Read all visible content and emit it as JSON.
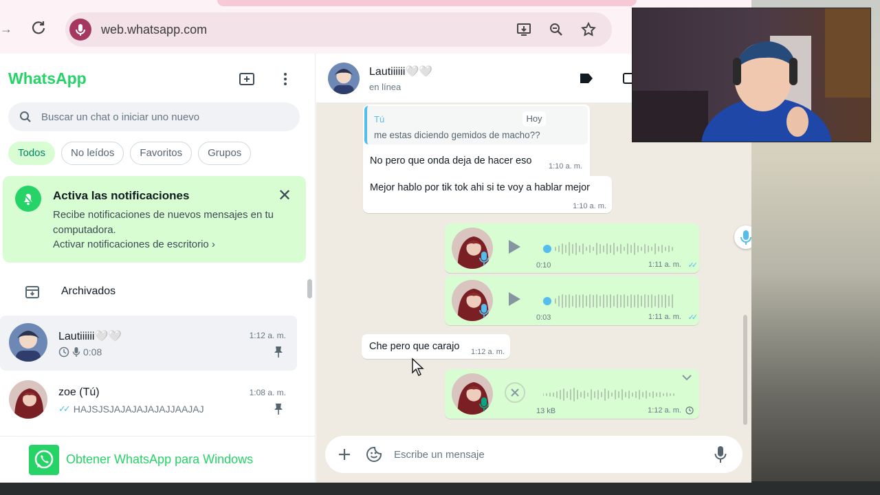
{
  "browser": {
    "url": "web.whatsapp.com"
  },
  "sidebar": {
    "brand": "WhatsApp",
    "search_placeholder": "Buscar un chat o iniciar uno nuevo",
    "filters": [
      "Todos",
      "No leídos",
      "Favoritos",
      "Grupos"
    ],
    "notification": {
      "title": "Activa las notificaciones",
      "body": "Recibe notificaciones de nuevos mensajes en tu computadora.",
      "link": "Activar notificaciones de escritorio ›"
    },
    "archived_label": "Archivados",
    "chats": [
      {
        "name": "Lautiiiiii🤍🤍",
        "time": "1:12 a. m.",
        "preview": "0:08"
      },
      {
        "name": "zoe (Tú)",
        "time": "1:08 a. m.",
        "preview": "HAJSJSJAJAJAJAJAJJAAJAJ"
      }
    ],
    "get_app_label": "Obtener WhatsApp para Windows"
  },
  "chat": {
    "contact_name": "Lautiiiiii🤍🤍",
    "contact_status": "en línea",
    "quote_author": "Tú",
    "quote_text": "me estas diciendo gemidos de macho??",
    "quote_day": "Hoy",
    "messages": [
      {
        "text": "No pero que onda deja de hacer eso",
        "time": "1:10 a. m."
      },
      {
        "text": "Mejor hablo por tik tok ahi si te voy a hablar mejor",
        "time": "1:10 a. m."
      },
      {
        "text": "Che pero que carajo",
        "time": "1:12 a. m."
      }
    ],
    "voice_notes": [
      {
        "duration": "0:10",
        "time": "1:11 a. m.",
        "progress": 0
      },
      {
        "duration": "0:03",
        "time": "1:11 a. m.",
        "progress": 0
      },
      {
        "duration": "13 kB",
        "time": "1:12 a. m.",
        "progress": 0
      }
    ],
    "compose_placeholder": "Escribe un mensaje"
  },
  "colors": {
    "brand_green": "#25d366",
    "outgoing_bubble": "#d9fdd3",
    "chat_bg": "#efeae2",
    "read_tick": "#53bdeb"
  }
}
